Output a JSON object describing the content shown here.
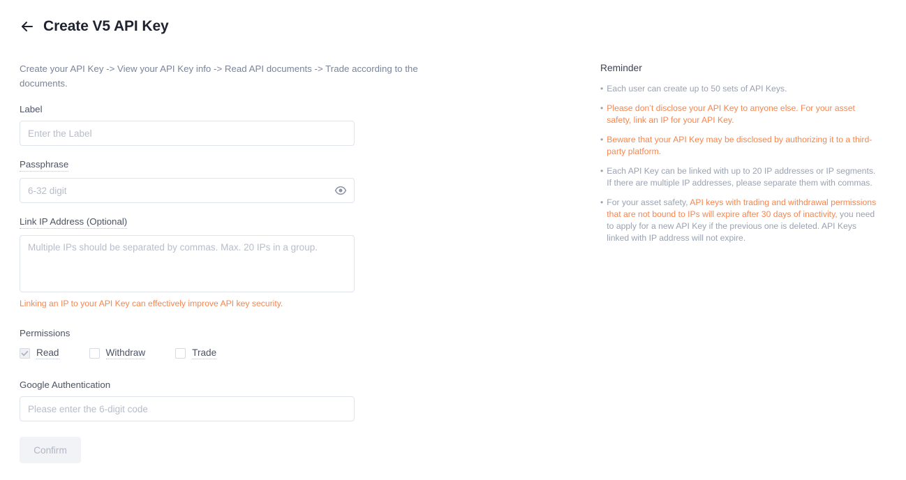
{
  "header": {
    "back_icon": "arrow-left-icon",
    "title": "Create V5 API Key"
  },
  "intro": "Create your API Key -> View your API Key info -> Read API documents -> Trade according to the documents.",
  "form": {
    "label_field": {
      "label": "Label",
      "placeholder": "Enter the Label",
      "value": ""
    },
    "passphrase_field": {
      "label": "Passphrase",
      "placeholder": "6-32 digit",
      "value": "",
      "toggle_icon": "eye-icon"
    },
    "link_ip_field": {
      "label": "Link IP Address (Optional)",
      "placeholder": "Multiple IPs should be separated by commas. Max. 20 IPs in a group.",
      "value": "",
      "hint": "Linking an IP to your API Key can effectively improve API key security."
    },
    "permissions": {
      "title": "Permissions",
      "items": [
        {
          "label": "Read",
          "checked": true
        },
        {
          "label": "Withdraw",
          "checked": false
        },
        {
          "label": "Trade",
          "checked": false
        }
      ]
    },
    "google_auth_field": {
      "label": "Google Authentication",
      "placeholder": "Please enter the 6-digit code",
      "value": ""
    },
    "confirm_label": "Confirm"
  },
  "reminder": {
    "title": "Reminder",
    "items": [
      {
        "parts": [
          {
            "text": "Each user can create up to 50 sets of API Keys.",
            "color": "gray"
          }
        ]
      },
      {
        "parts": [
          {
            "text": "Please don’t disclose your API Key to anyone else. For your asset safety, link an IP for your API Key.",
            "color": "orange"
          }
        ]
      },
      {
        "parts": [
          {
            "text": "Beware that your API Key may be disclosed by authorizing it to a third-party platform.",
            "color": "orange"
          }
        ]
      },
      {
        "parts": [
          {
            "text": "Each API Key can be linked with up to 20 IP addresses or IP segments. If there are multiple IP addresses, please separate them with commas.",
            "color": "gray"
          }
        ]
      },
      {
        "parts": [
          {
            "text": "For your asset safety, ",
            "color": "gray"
          },
          {
            "text": "API keys with trading and withdrawal permissions that are not bound to IPs will expire after 30 days of inactivity,",
            "color": "orange"
          },
          {
            "text": " you need to apply for a new API Key if the previous one is deleted. API Keys linked with IP address will not expire.",
            "color": "gray"
          }
        ]
      }
    ]
  },
  "colors": {
    "orange": "#f5864f",
    "gray_text": "#9aa2b1",
    "border": "#dfe3ec",
    "title": "#1f2330"
  }
}
